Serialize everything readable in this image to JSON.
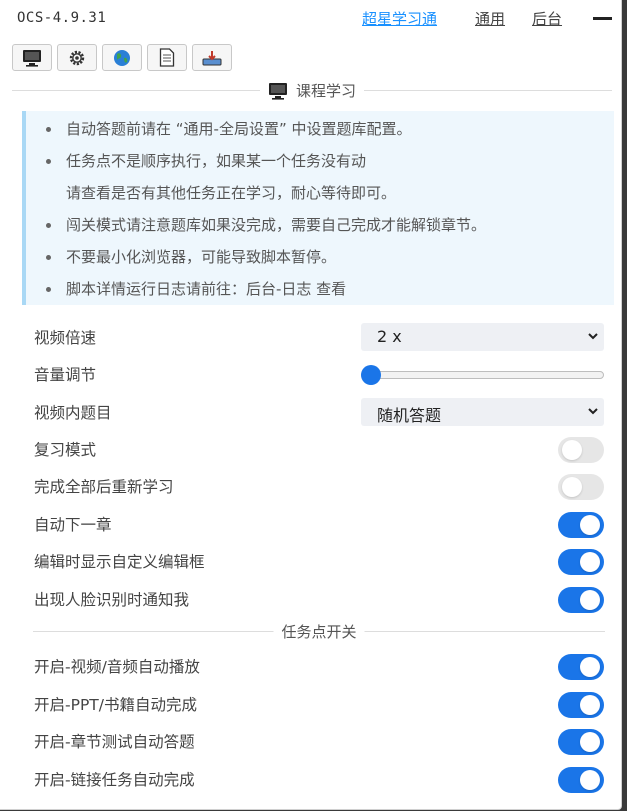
{
  "app": {
    "title": "OCS-4.9.31"
  },
  "nav": {
    "items": [
      "超星学习通",
      "通用",
      "后台"
    ]
  },
  "toolbar": {
    "icons": [
      "monitor-icon",
      "gear-icon",
      "globe-icon",
      "document-icon",
      "tray-icon"
    ]
  },
  "section": {
    "title": "课程学习",
    "icon": "monitor-icon"
  },
  "notice": {
    "items": [
      "自动答题前请在 “通用-全局设置” 中设置题库配置。",
      "任务点不是顺序执行，如果某一个任务没有动",
      "请查看是否有其他任务正在学习，耐心等待即可。",
      "闯关模式请注意题库如果没完成，需要自己完成才能解锁章节。",
      "不要最小化浏览器，可能导致脚本暂停。",
      "脚本详情运行日志请前往：后台-日志 查看"
    ]
  },
  "settings": {
    "speed_label": "视频倍速",
    "speed_value": "2 x",
    "volume_label": "音量调节",
    "volume_level": 0,
    "question_label": "视频内题目",
    "question_value": "随机答题",
    "toggles": [
      {
        "label": "复习模式",
        "on": false
      },
      {
        "label": "完成全部后重新学习",
        "on": false
      },
      {
        "label": "自动下一章",
        "on": true
      },
      {
        "label": "编辑时显示自定义编辑框",
        "on": true
      },
      {
        "label": "出现人脸识别时通知我",
        "on": true
      }
    ]
  },
  "task_section": {
    "title": "任务点开关"
  },
  "task_toggles": [
    {
      "label": "开启-视频/音频自动播放",
      "on": true
    },
    {
      "label": "开启-PPT/书籍自动完成",
      "on": true
    },
    {
      "label": "开启-章节测试自动答题",
      "on": true
    },
    {
      "label": "开启-链接任务自动完成",
      "on": true
    }
  ],
  "colors": {
    "accent": "#1a75e8",
    "link": "#1890ff",
    "notice_bg": "#eef7fd"
  }
}
